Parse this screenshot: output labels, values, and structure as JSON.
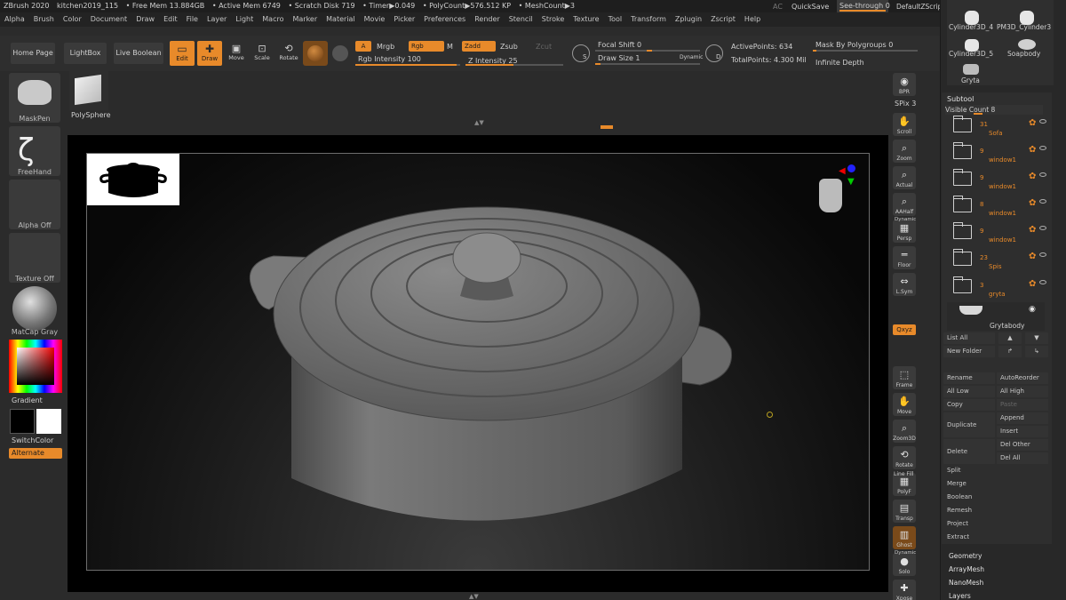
{
  "titlebar": {
    "app": "ZBrush 2020",
    "file": "kitchen2019_115",
    "free_mem": "• Free Mem 13.884GB",
    "active_mem": "• Active Mem 6749",
    "scratch": "• Scratch Disk 719",
    "timer": "• Timer▶0.049",
    "polycount": "• PolyCount▶576.512 KP",
    "meshcount": "• MeshCount▶3",
    "ac": "AC",
    "quicksave": "QuickSave",
    "see_through": "See-through 0",
    "zscript": "DefaultZScript"
  },
  "menu": [
    "Alpha",
    "Brush",
    "Color",
    "Document",
    "Draw",
    "Edit",
    "File",
    "Layer",
    "Light",
    "Macro",
    "Marker",
    "Material",
    "Movie",
    "Picker",
    "Preferences",
    "Render",
    "Stencil",
    "Stroke",
    "Texture",
    "Tool",
    "Transform",
    "Zplugin",
    "Zscript",
    "Help"
  ],
  "shelf": {
    "home": "Home Page",
    "lightbox": "LightBox",
    "live_boolean": "Live Boolean",
    "edit": "Edit",
    "draw": "Draw",
    "move": "Move",
    "scale": "Scale",
    "rotate": "Rotate",
    "a": "A",
    "mrgb": "Mrgb",
    "rgb": "Rgb",
    "m": "M",
    "zadd": "Zadd",
    "zsub": "Zsub",
    "zcut": "Zcut",
    "rgb_intensity": "Rgb Intensity 100",
    "z_intensity": "Z Intensity 25",
    "focal_shift": "Focal Shift 0",
    "draw_size": "Draw Size 1",
    "dynamic": "Dynamic",
    "active_points": "ActivePoints: 634",
    "total_points": "TotalPoints: 4.300 Mil",
    "mask_polygroups": "Mask By Polygroups 0",
    "infinite_depth": "Infinite Depth",
    "s": "S",
    "d": "D"
  },
  "left": {
    "maskpen": "MaskPen",
    "polysphere": "PolySphere",
    "freehand": "FreeHand",
    "alpha_off": "Alpha Off",
    "texture_off": "Texture Off",
    "matcap": "MatCap Gray",
    "gradient": "Gradient",
    "switchcolor": "SwitchColor",
    "alternate": "Alternate"
  },
  "vtools": {
    "bpr": "BPR",
    "spix": "SPix 3",
    "scroll": "Scroll",
    "zoom": "Zoom",
    "actual": "Actual",
    "aahalf": "AAHalf",
    "dynamic": "Dynamic",
    "persp": "Persp",
    "floor": "Floor",
    "lsym": "L.Sym",
    "xyz": "Qxyz",
    "frame": "Frame",
    "move": "Move",
    "zoom3d": "Zoom3D",
    "rotate": "Rotate",
    "linefill": "Line Fill",
    "polyf": "PolyF",
    "transp": "Transp",
    "ghost": "Ghost",
    "dynamic2": "Dynamic",
    "solo": "Solo",
    "xpose": "Xpose"
  },
  "right": {
    "tool_thumbs": [
      "Cylinder3D_4",
      "PM3D_Cylinder3",
      "Cylinder3D_5",
      "Soapbody",
      "Gryta"
    ],
    "subtool_title": "Subtool",
    "visible_count": "Visible Count 8",
    "subtools": [
      {
        "count": "31",
        "name": "Sofa"
      },
      {
        "count": "9",
        "name": "window1"
      },
      {
        "count": "9",
        "name": "window1"
      },
      {
        "count": "8",
        "name": "window1"
      },
      {
        "count": "9",
        "name": "window1"
      },
      {
        "count": "23",
        "name": "Spis"
      },
      {
        "count": "3",
        "name": "gryta"
      }
    ],
    "selected_item": "Grytabody",
    "list_all": "List All",
    "new_folder": "New Folder",
    "rename": "Rename",
    "autoreorder": "AutoReorder",
    "all_low": "All Low",
    "all_high": "All High",
    "copy": "Copy",
    "paste": "Paste",
    "duplicate": "Duplicate",
    "append": "Append",
    "insert": "Insert",
    "delete": "Delete",
    "del_other": "Del Other",
    "del_all": "Del All",
    "menu": [
      "Split",
      "Merge",
      "Boolean",
      "Remesh",
      "Project",
      "Extract"
    ],
    "sections": [
      "Geometry",
      "ArrayMesh",
      "NanoMesh",
      "Layers"
    ]
  },
  "colors": {
    "accent": "#e88a2a",
    "bg": "#2b2b2b",
    "viewport": "#000000"
  }
}
